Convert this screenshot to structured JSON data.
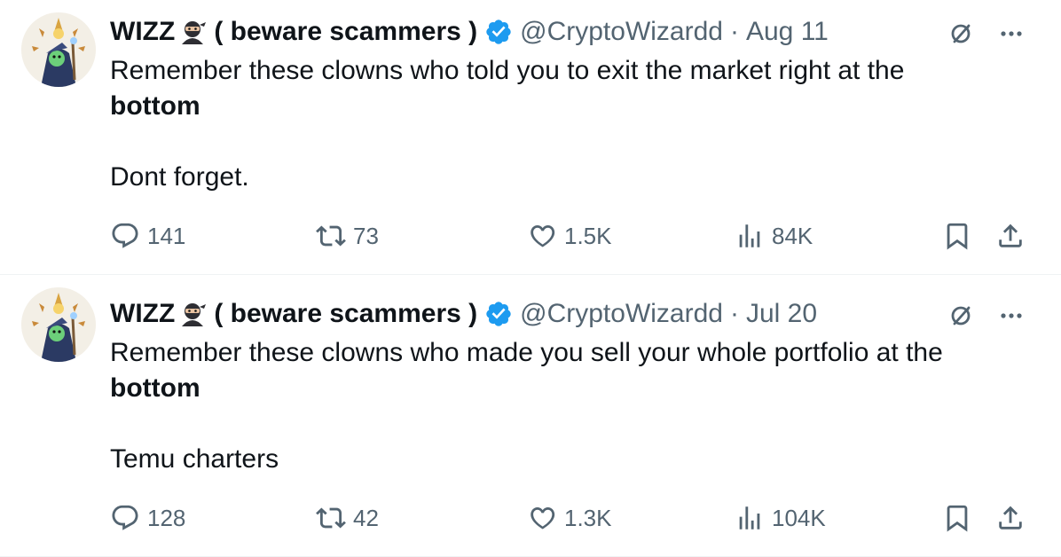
{
  "colors": {
    "text": "#0f1419",
    "muted": "#536471",
    "verified": "#1d9bf0",
    "divider": "#eff3f4"
  },
  "icons": {
    "reply": "reply-icon",
    "retweet": "retweet-icon",
    "like": "heart-icon",
    "views": "views-bar-chart-icon",
    "bookmark": "bookmark-icon",
    "share": "share-icon",
    "verified": "verified-badge-icon",
    "grok": "grok-icon",
    "more": "more-dots-icon"
  },
  "tweets": [
    {
      "author": {
        "name_prefix": "WIZZ",
        "name_suffix": "( beware scammers )",
        "handle": "@CryptoWizardd"
      },
      "separator": "·",
      "date": "Aug 11",
      "text": {
        "line1": "Remember these clowns who told you to exit the market right at the",
        "bold": "bottom",
        "line3": "Dont forget."
      },
      "stats": {
        "replies": "141",
        "retweets": "73",
        "likes": "1.5K",
        "views": "84K"
      }
    },
    {
      "author": {
        "name_prefix": "WIZZ",
        "name_suffix": "( beware scammers )",
        "handle": "@CryptoWizardd"
      },
      "separator": "·",
      "date": "Jul 20",
      "text": {
        "line1": "Remember these clowns who made you sell your whole portfolio at the",
        "bold": "bottom",
        "line3": "Temu charters"
      },
      "stats": {
        "replies": "128",
        "retweets": "42",
        "likes": "1.3K",
        "views": "104K"
      }
    }
  ]
}
